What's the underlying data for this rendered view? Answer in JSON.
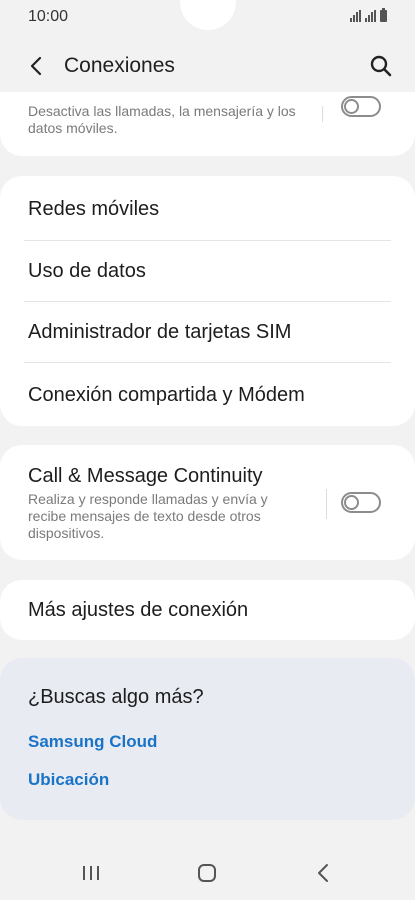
{
  "status": {
    "time": "10:00"
  },
  "header": {
    "title": "Conexiones"
  },
  "airplane": {
    "description": "Desactiva las llamadas, la mensajería y los datos móviles.",
    "enabled": false
  },
  "network_items": [
    {
      "label": "Redes móviles"
    },
    {
      "label": "Uso de datos"
    },
    {
      "label": "Administrador de tarjetas SIM"
    },
    {
      "label": "Conexión compartida y Módem"
    }
  ],
  "continuity": {
    "title": "Call & Message Continuity",
    "description": "Realiza y responde llamadas y envía y recibe mensajes de texto desde otros dispositivos.",
    "enabled": false
  },
  "more": {
    "label": "Más ajustes de conexión"
  },
  "suggestions": {
    "title": "¿Buscas algo más?",
    "links": [
      {
        "label": "Samsung Cloud"
      },
      {
        "label": "Ubicación"
      }
    ]
  },
  "colors": {
    "accent": "#1a73c7",
    "background": "#f2f2f2",
    "card": "#ffffff",
    "suggest_card": "#e8ecf2"
  },
  "icons": {
    "back": "chevron-left-icon",
    "search": "search-icon",
    "nav_recents": "recents-icon",
    "nav_home": "home-icon",
    "nav_back": "back-icon"
  }
}
